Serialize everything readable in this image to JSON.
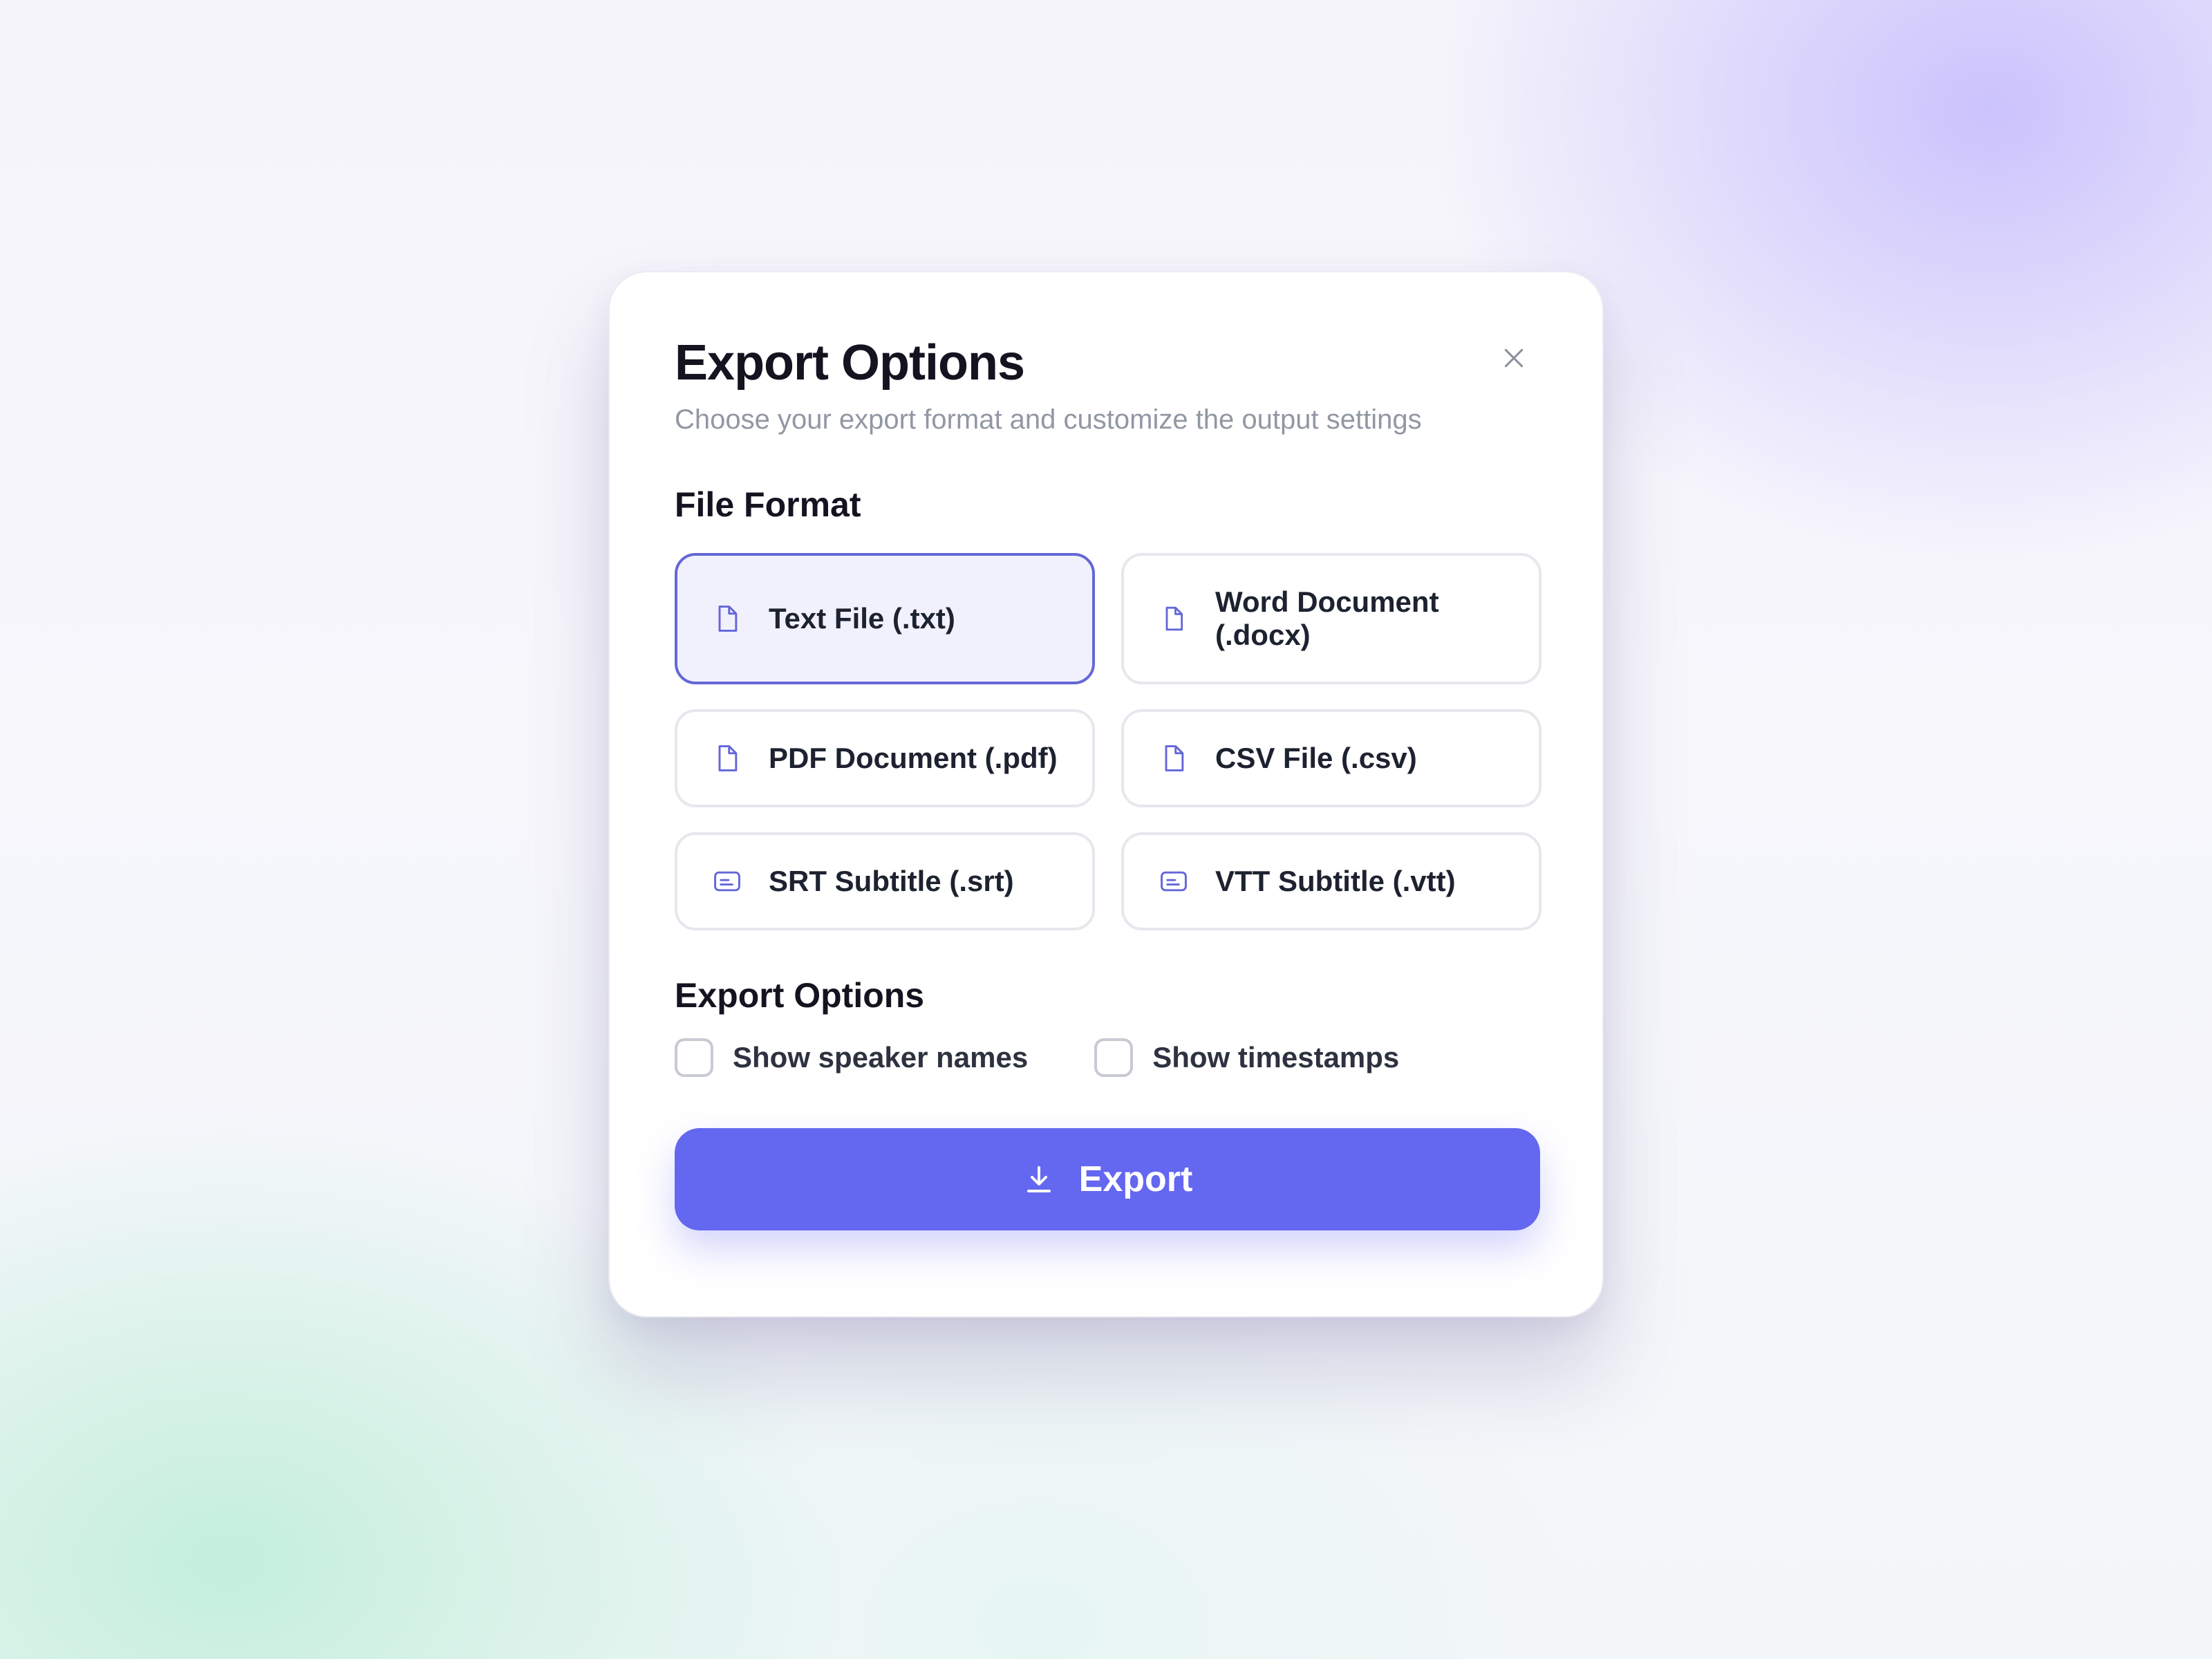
{
  "dialog": {
    "title": "Export Options",
    "subtitle": "Choose your export format and customize the output settings",
    "close_icon": "close-icon"
  },
  "file_format": {
    "heading": "File Format",
    "selected": "txt",
    "options": [
      {
        "id": "txt",
        "label": "Text File (.txt)",
        "icon": "file-icon",
        "selected": true
      },
      {
        "id": "docx",
        "label": "Word Document (.docx)",
        "icon": "file-icon",
        "selected": false
      },
      {
        "id": "pdf",
        "label": "PDF Document (.pdf)",
        "icon": "file-icon",
        "selected": false
      },
      {
        "id": "csv",
        "label": "CSV File (.csv)",
        "icon": "file-icon",
        "selected": false
      },
      {
        "id": "srt",
        "label": "SRT Subtitle (.srt)",
        "icon": "subtitles-icon",
        "selected": false
      },
      {
        "id": "vtt",
        "label": "VTT Subtitle (.vtt)",
        "icon": "subtitles-icon",
        "selected": false
      }
    ]
  },
  "export_options": {
    "heading": "Export Options",
    "checkboxes": [
      {
        "label": "Show speaker names",
        "checked": false
      },
      {
        "label": "Show timestamps",
        "checked": false
      }
    ]
  },
  "export_button": {
    "label": "Export",
    "icon": "download-icon"
  },
  "colors": {
    "accent": "#6467f0",
    "selected_border": "#6567d6",
    "selected_bg": "#f1f1fd",
    "icon": "#6466d8"
  }
}
